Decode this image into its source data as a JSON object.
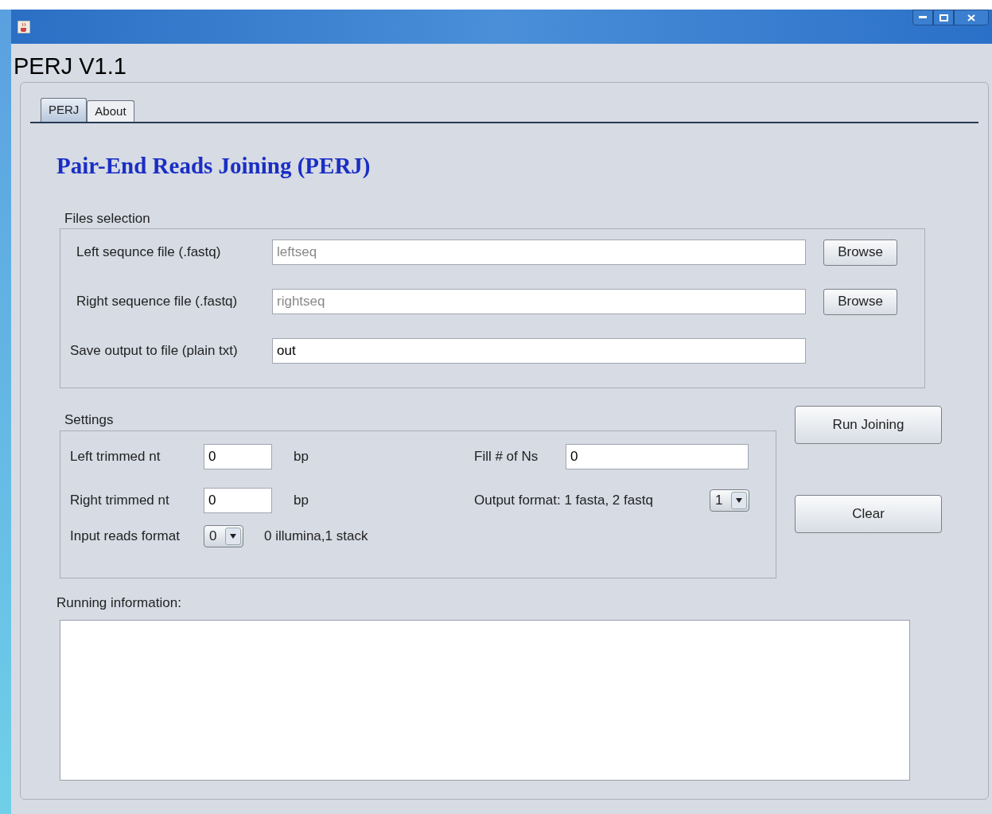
{
  "window": {
    "app_title": "PERJ V1.1"
  },
  "tabs": [
    {
      "label": "PERJ",
      "selected": true
    },
    {
      "label": "About",
      "selected": false
    }
  ],
  "heading": "Pair-End Reads Joining (PERJ)",
  "files_selection": {
    "title": "Files selection",
    "rows": [
      {
        "label": "Left sequnce file (.fastq)",
        "placeholder": "leftseq",
        "button": "Browse"
      },
      {
        "label": "Right sequence file (.fastq)",
        "placeholder": "rightseq",
        "button": "Browse"
      },
      {
        "label": "Save output to file (plain txt)",
        "value": "out"
      }
    ]
  },
  "settings": {
    "title": "Settings",
    "left_trimmed": {
      "label": "Left trimmed nt",
      "value": "0",
      "unit": "bp"
    },
    "right_trimmed": {
      "label": "Right trimmed nt",
      "value": "0",
      "unit": "bp"
    },
    "input_format": {
      "label": "Input reads format",
      "value": "0",
      "hint": "0 illumina,1 stack"
    },
    "fill_ns": {
      "label": "Fill # of Ns",
      "value": "0"
    },
    "output_format": {
      "label": "Output format: 1 fasta, 2 fastq",
      "value": "1"
    }
  },
  "buttons": [
    "Run Joining",
    "Clear"
  ],
  "running_info": {
    "label": "Running information:"
  }
}
